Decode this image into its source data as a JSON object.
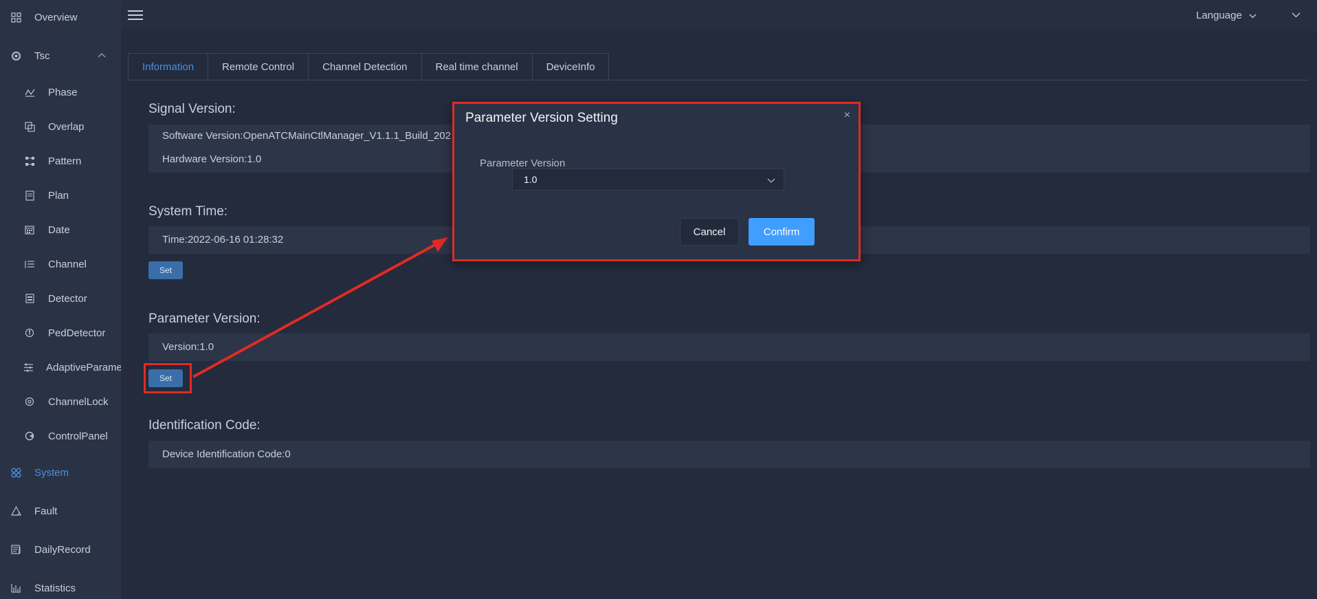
{
  "sidebar": {
    "items": [
      {
        "label": "Overview",
        "icon": "grid-icon"
      },
      {
        "label": "Tsc",
        "icon": "target-icon",
        "expanded": true
      },
      {
        "label": "Phase",
        "icon": "phase-icon"
      },
      {
        "label": "Overlap",
        "icon": "overlap-icon"
      },
      {
        "label": "Pattern",
        "icon": "pattern-icon"
      },
      {
        "label": "Plan",
        "icon": "plan-icon"
      },
      {
        "label": "Date",
        "icon": "calendar-icon"
      },
      {
        "label": "Channel",
        "icon": "channel-icon"
      },
      {
        "label": "Detector",
        "icon": "detector-icon"
      },
      {
        "label": "PedDetector",
        "icon": "pedestrian-icon"
      },
      {
        "label": "AdaptiveParameter",
        "icon": "sliders-icon"
      },
      {
        "label": "ChannelLock",
        "icon": "lock-icon"
      },
      {
        "label": "ControlPanel",
        "icon": "control-panel-icon"
      },
      {
        "label": "System",
        "icon": "system-icon",
        "active": true
      },
      {
        "label": "Fault",
        "icon": "warning-icon"
      },
      {
        "label": "DailyRecord",
        "icon": "record-icon"
      },
      {
        "label": "Statistics",
        "icon": "statistics-icon"
      }
    ],
    "active_color": "#4a90e2"
  },
  "header": {
    "language_label": "Language"
  },
  "tabs": [
    "Information",
    "Remote Control",
    "Channel Detection",
    "Real time channel",
    "DeviceInfo"
  ],
  "main": {
    "signal_title": "Signal Version:",
    "software_version": "Software Version:OpenATCMainCtlManager_V1.1.1_Build_202",
    "hardware_version": "Hardware Version:1.0",
    "system_time_title": "System Time:",
    "time_value": "Time:2022-06-16 01:28:32",
    "set_label": "Set",
    "parameter_title": "Parameter Version:",
    "version_value": "Version:1.0",
    "identification_title": "Identification Code:",
    "device_code": "Device Identification Code:0"
  },
  "dialog": {
    "title": "Parameter Version Setting",
    "field_label": "Parameter Version",
    "selected_value": "1.0",
    "cancel_label": "Cancel",
    "confirm_label": "Confirm",
    "close_symbol": "×"
  },
  "colors": {
    "background": "#232b3d",
    "sidebar": "#2a3245",
    "accent": "#409eff",
    "annotation": "#e02b24"
  }
}
